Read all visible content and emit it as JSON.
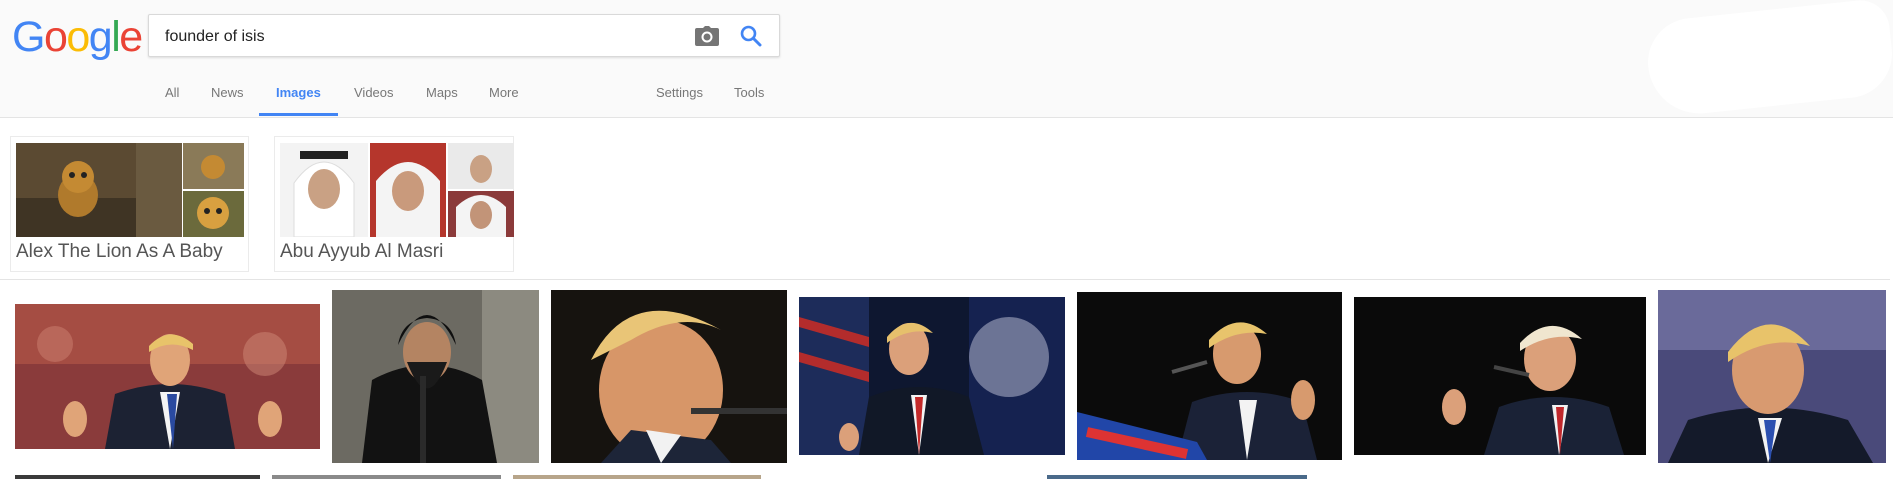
{
  "logo": {
    "letters": [
      "G",
      "o",
      "o",
      "g",
      "l",
      "e"
    ]
  },
  "search": {
    "query": "founder of isis"
  },
  "nav": {
    "tabs": [
      {
        "label": "All"
      },
      {
        "label": "News"
      },
      {
        "label": "Images"
      },
      {
        "label": "Videos"
      },
      {
        "label": "Maps"
      },
      {
        "label": "More"
      }
    ],
    "settings": "Settings",
    "tools": "Tools",
    "active": "Images"
  },
  "related": [
    {
      "label": "Alex The Lion As A Baby"
    },
    {
      "label": "Abu Ayyub Al Masri"
    }
  ],
  "icons": {
    "camera": "camera-icon",
    "search": "search-icon",
    "apps": "apps-grid-icon",
    "notifications": "bell-icon"
  },
  "colors": {
    "accent": "#4285f4",
    "header_bg": "#fafafa",
    "nav_text": "#777777"
  }
}
